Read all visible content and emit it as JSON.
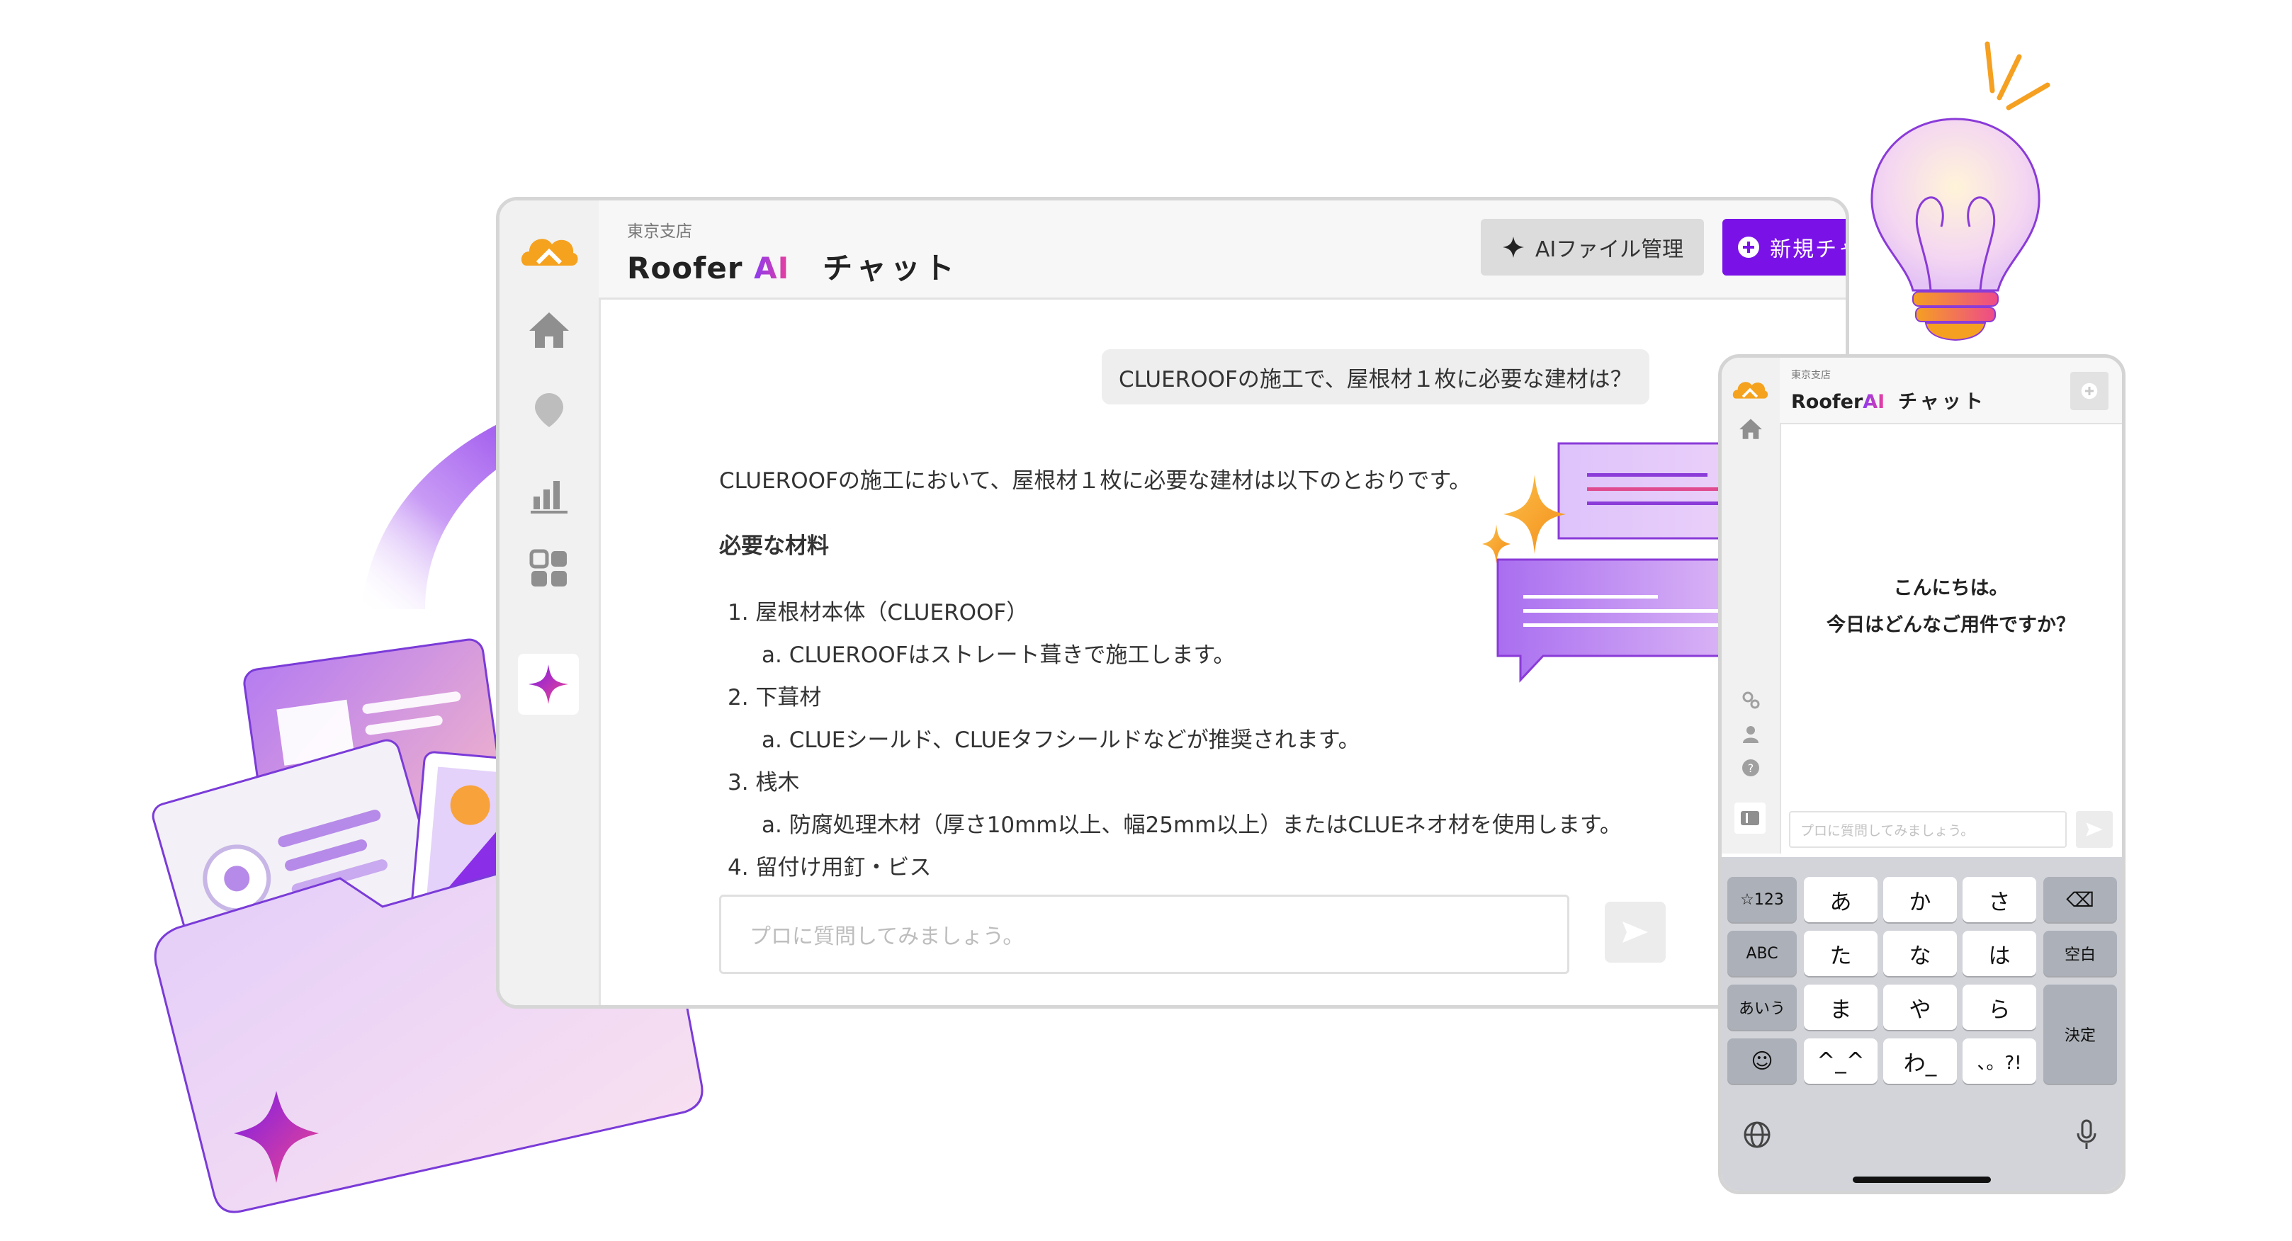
{
  "desktop": {
    "branch": "東京支店",
    "title_prefix": "Roofer ",
    "title_ai": "AI",
    "title_suffix": "チャット",
    "ai_files_button": "AIファイル管理",
    "new_chat_button": "新規チャット",
    "user_message": "CLUEROOFの施工で、屋根材１枚に必要な建材は？",
    "answer": {
      "intro": "CLUEROOFの施工において、屋根材１枚に必要な建材は以下のとおりです。",
      "heading": "必要な材料",
      "items": [
        {
          "label": "1. 屋根材本体（CLUEROOF）",
          "sub": "a. CLUEROOFはストレート葺きで施工します。"
        },
        {
          "label": "2. 下葺材",
          "sub": "a. CLUEシールド、CLUEタフシールドなどが推奨されます。"
        },
        {
          "label": "3. 桟木",
          "sub": "a. 防腐処理木材（厚さ10mm以上、幅25mm以上）またはCLUEネオ材を使用します。"
        },
        {
          "label": "4. 留付け用釘・ビス"
        }
      ]
    },
    "input_placeholder": "プロに質問してみましょう。",
    "sidebar_icons": [
      "logo-icon",
      "home-icon",
      "map-pin-icon",
      "bar-chart-icon",
      "grid-icon",
      "ai-sparkle-icon"
    ]
  },
  "mobile": {
    "branch": "東京支店",
    "title_prefix": "Roofer",
    "title_ai": "AI",
    "title_suffix": "チャット",
    "greeting_line1": "こんにちは。",
    "greeting_line2": "今日はどんなご用件ですか？",
    "input_placeholder": "プロに質問してみましょう。",
    "keyboard": {
      "rows": [
        [
          "☆123",
          "あ",
          "か",
          "さ",
          "⌫"
        ],
        [
          "ABC",
          "た",
          "な",
          "は",
          "空白"
        ],
        [
          "あいう",
          "ま",
          "や",
          "ら",
          "決定"
        ],
        [
          "☺",
          "^_^",
          "わ_",
          "、。?!"
        ]
      ]
    }
  },
  "colors": {
    "accent": "#7a12e8",
    "ai_gradient_start": "#8b3bf0",
    "ai_gradient_end": "#ec3f9a",
    "logo_orange": "#f5a623"
  }
}
